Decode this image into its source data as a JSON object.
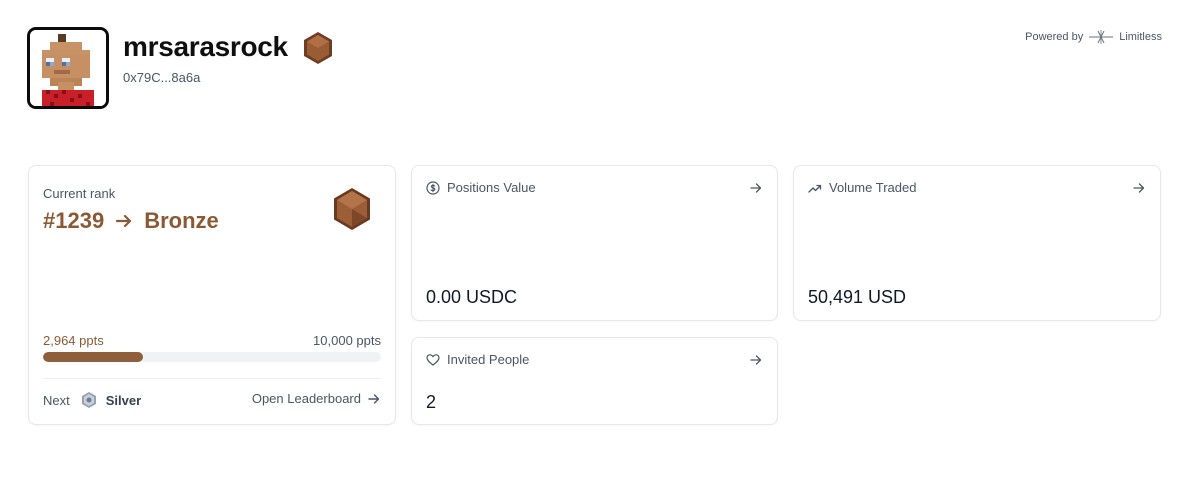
{
  "profile": {
    "username": "mrsarasrock",
    "address": "0x79C...8a6a",
    "avatar_icon": "pixel-avatar",
    "badge_icon": "bronze-hexagon-badge"
  },
  "powered_by": {
    "label": "Powered by",
    "brand": "Limitless"
  },
  "rank_card": {
    "label": "Current rank",
    "rank": "#1239",
    "tier": "Bronze",
    "tier_color": "#8b5a35",
    "points_current": "2,964 ppts",
    "points_max": "10,000 ppts",
    "progress_fraction": 0.2964,
    "next_label": "Next",
    "next_tier": "Silver",
    "leaderboard_label": "Open Leaderboard"
  },
  "positions_card": {
    "title": "Positions Value",
    "icon": "dollar-circle-icon",
    "value": "0.00 USDC"
  },
  "volume_card": {
    "title": "Volume Traded",
    "icon": "trending-up-icon",
    "value": "50,491 USD"
  },
  "invited_card": {
    "title": "Invited People",
    "icon": "heart-icon",
    "value": "2"
  }
}
